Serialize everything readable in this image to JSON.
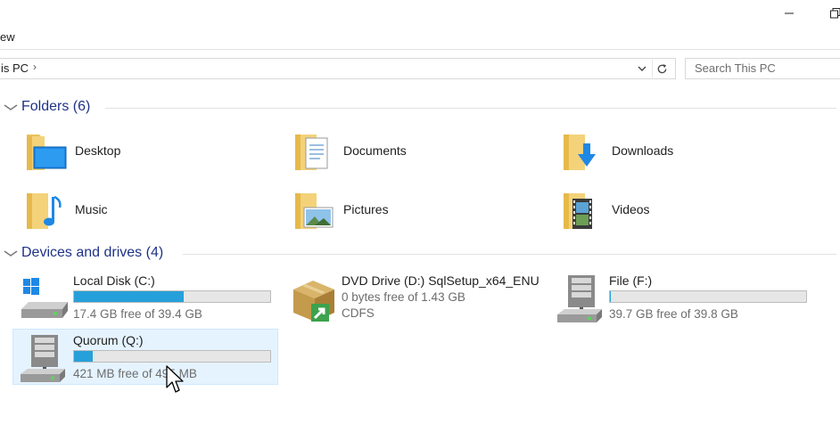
{
  "window": {
    "minimize_icon": "minimize-icon",
    "maximize_icon": "restore-icon"
  },
  "ribbon": {
    "view_tab": "ew"
  },
  "address": {
    "path_text": "is PC",
    "separator": "›",
    "dropdown_icon": "chevron-down-icon",
    "refresh_icon": "refresh-icon"
  },
  "search": {
    "placeholder": "Search This PC"
  },
  "groups": {
    "folders": {
      "title": "Folders (6)"
    },
    "drives": {
      "title": "Devices and drives (4)"
    }
  },
  "folders": [
    {
      "label": "Desktop",
      "icon": "desktop-folder-icon"
    },
    {
      "label": "Documents",
      "icon": "documents-folder-icon"
    },
    {
      "label": "Downloads",
      "icon": "downloads-folder-icon"
    },
    {
      "label": "Music",
      "icon": "music-folder-icon"
    },
    {
      "label": "Pictures",
      "icon": "pictures-folder-icon"
    },
    {
      "label": "Videos",
      "icon": "videos-folder-icon"
    }
  ],
  "drives": [
    {
      "name": "Local Disk (C:)",
      "free_text": "17.4 GB free of 39.4 GB",
      "used_fraction": 0.558,
      "icon": "windows-drive-icon"
    },
    {
      "name": "DVD Drive (D:) SqlSetup_x64_ENU",
      "free_text": "0 bytes free of 1.43 GB",
      "filesystem": "CDFS",
      "icon": "dvd-drive-icon"
    },
    {
      "name": "File (F:)",
      "free_text": "39.7 GB free of 39.8 GB",
      "used_fraction": 0.0025,
      "icon": "network-drive-icon"
    },
    {
      "name": "Quorum (Q:)",
      "free_text": "421 MB free of 495 MB",
      "used_fraction": 0.095,
      "icon": "network-drive-icon"
    }
  ],
  "colors": {
    "accent_bar": "#26a0da",
    "group_header": "#1e3287",
    "selection_bg": "#e5f3ff"
  }
}
